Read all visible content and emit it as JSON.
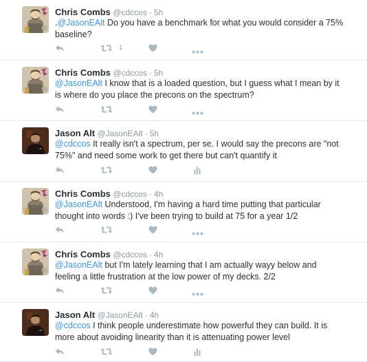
{
  "tweets": [
    {
      "fullname": "Chris Combs",
      "username": "@cdccos",
      "separator": "·",
      "time": "5h",
      "text_prefix": ".",
      "mention": "@JasonEAlt",
      "text": " Do you have a benchmark for what you would consider a 75% baseline?",
      "avatar": "bearded-knight-avatar",
      "retweet_count": "1",
      "fourth_action": "more-icon"
    },
    {
      "fullname": "Chris Combs",
      "username": "@cdccos",
      "separator": "·",
      "time": "5h",
      "text_prefix": "",
      "mention": "@JasonEAlt",
      "text": " I know that is a loaded question, but I guess what I mean by it is where do you place the precons on the spectrum?",
      "avatar": "bearded-knight-avatar",
      "retweet_count": "",
      "fourth_action": "more-icon"
    },
    {
      "fullname": "Jason Alt",
      "username": "@JasonEAlt",
      "separator": "·",
      "time": "5h",
      "text_prefix": "",
      "mention": "@cdccos",
      "text": " It really isn't a spectrum, per se. I would say the precons are \"not 75%\" and need some work to get there but can't quantify it",
      "avatar": "dark-photo-avatar",
      "retweet_count": "",
      "fourth_action": "analytics-icon"
    },
    {
      "fullname": "Chris Combs",
      "username": "@cdccos",
      "separator": "·",
      "time": "4h",
      "text_prefix": "",
      "mention": "@JasonEAlt",
      "text": " Understood, I'm having a hard time putting that particular thought into words :)  I've been trying to build at 75 for a year 1/2",
      "avatar": "bearded-knight-avatar",
      "retweet_count": "",
      "fourth_action": "more-icon"
    },
    {
      "fullname": "Chris Combs",
      "username": "@cdccos",
      "separator": "·",
      "time": "4h",
      "text_prefix": "",
      "mention": "@JasonEAlt",
      "text": "  but I'm lately learning that I am actually wayy below and feeling a little frustration at the low power of my decks. 2/2",
      "avatar": "bearded-knight-avatar",
      "retweet_count": "",
      "fourth_action": "more-icon"
    },
    {
      "fullname": "Jason Alt",
      "username": "@JasonEAlt",
      "separator": "·",
      "time": "4h",
      "text_prefix": "",
      "mention": "@cdccos",
      "text": " I think people underestimate how powerful they can build. It is more about avoiding linearity than it is attenuating power level",
      "avatar": "dark-photo-avatar",
      "retweet_count": "",
      "fourth_action": "analytics-icon"
    }
  ],
  "colors": {
    "mention": "#3b94d9",
    "name": "#292f33",
    "meta": "#8899a6",
    "icon": "#aab8c2",
    "divider": "#e1e8ed"
  }
}
